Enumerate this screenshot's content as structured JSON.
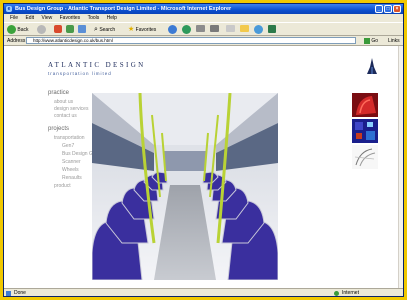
{
  "browser": {
    "title": "Bus Design Group - Atlantic Transport Design Limited - Microsoft Internet Explorer",
    "menu": [
      "File",
      "Edit",
      "View",
      "Favorites",
      "Tools",
      "Help"
    ],
    "toolbar": {
      "back": "Back",
      "search": "Search",
      "favorites": "Favorites"
    },
    "address_label": "Address",
    "address_value": "http://www.atlanticdesign.co.uk/bus.html",
    "go_label": "Go",
    "links_label": "Links",
    "status_left": "Done",
    "status_right": "Internet"
  },
  "site": {
    "logo_top": "ATLANTIC DESIGN",
    "logo_bottom": "transportation limited",
    "nav": {
      "practice_heading": "practice",
      "practice_items": [
        "about us",
        "design services",
        "contact us"
      ],
      "projects_heading": "projects",
      "transportation": "transportation",
      "transport_items": [
        "Gen7",
        "Bus Design Group",
        "Scanner",
        "Wheels",
        "Renaults"
      ],
      "product": "product"
    }
  },
  "colors": {
    "accent": "#1c2a5a",
    "nav_text": "#9a9a9a",
    "titlebar": "#0a4fd0"
  }
}
